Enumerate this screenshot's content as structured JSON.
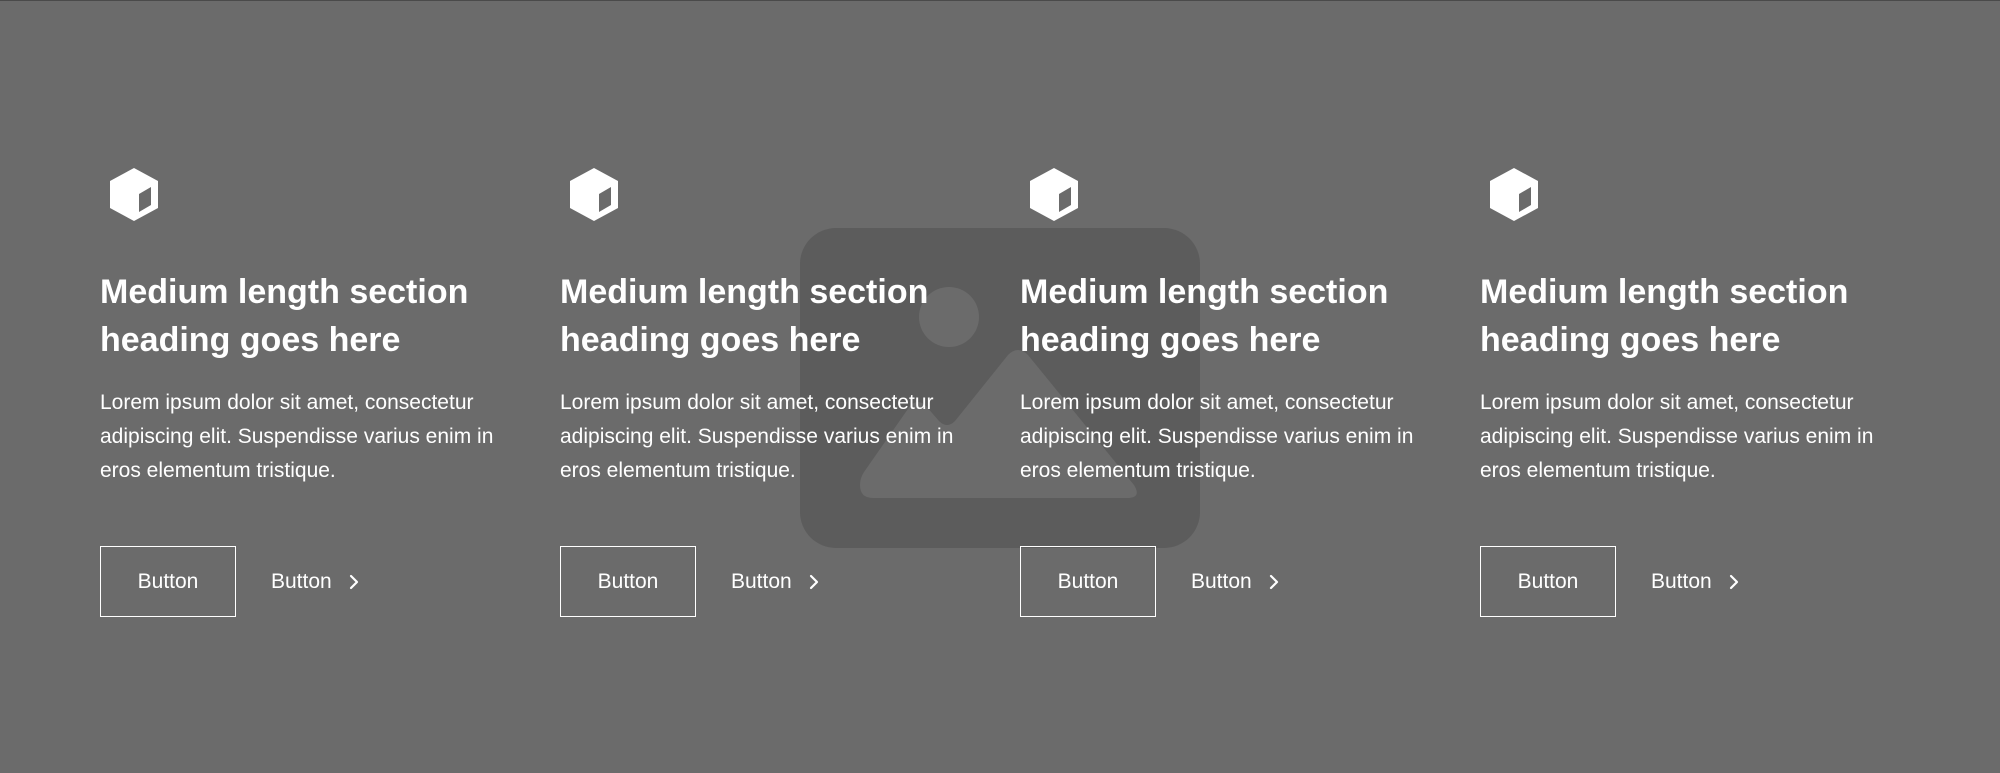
{
  "background_color": "#6b6b6b",
  "placeholder_image": {
    "icon": "image-placeholder-icon"
  },
  "features": [
    {
      "icon": "cube-icon",
      "heading": "Medium length section heading goes here",
      "text": "Lorem ipsum dolor sit amet, consectetur adipiscing elit. Suspendisse varius enim in eros elementum tristique.",
      "primary_button": "Button",
      "secondary_button": "Button"
    },
    {
      "icon": "cube-icon",
      "heading": "Medium length section heading goes here",
      "text": "Lorem ipsum dolor sit amet, consectetur adipiscing elit. Suspendisse varius enim in eros elementum tristique.",
      "primary_button": "Button",
      "secondary_button": "Button"
    },
    {
      "icon": "cube-icon",
      "heading": "Medium length section heading goes here",
      "text": "Lorem ipsum dolor sit amet, consectetur adipiscing elit. Suspendisse varius enim in eros elementum tristique.",
      "primary_button": "Button",
      "secondary_button": "Button"
    },
    {
      "icon": "cube-icon",
      "heading": "Medium length section heading goes here",
      "text": "Lorem ipsum dolor sit amet, consectetur adipiscing elit. Suspendisse varius enim in eros elementum tristique.",
      "primary_button": "Button",
      "secondary_button": "Button"
    }
  ]
}
